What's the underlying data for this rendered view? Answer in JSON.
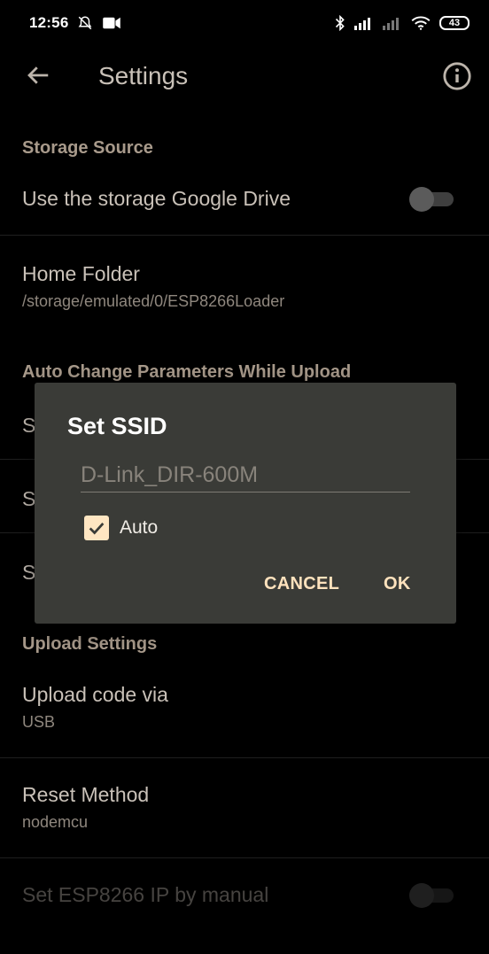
{
  "status": {
    "time": "12:56",
    "battery": "43"
  },
  "appbar": {
    "title": "Settings"
  },
  "sections": {
    "storage": "Storage Source",
    "auto_change": "Auto Change Parameters While Upload",
    "upload": "Upload Settings"
  },
  "rows": {
    "google_drive": {
      "title": "Use the storage Google Drive",
      "enabled": false
    },
    "home_folder": {
      "title": "Home Folder",
      "value": "/storage/emulated/0/ESP8266Loader"
    },
    "hidden_1": "S",
    "hidden_2": "S",
    "hidden_3": "S",
    "upload_via": {
      "title": "Upload code via",
      "value": "USB"
    },
    "reset_method": {
      "title": "Reset Method",
      "value": "nodemcu"
    },
    "manual_ip": {
      "title": "Set ESP8266 IP by manual",
      "enabled": false
    }
  },
  "dialog": {
    "title": "Set SSID",
    "input_value": "D-Link_DIR-600M",
    "checkbox_label": "Auto",
    "checkbox_checked": true,
    "cancel_label": "CANCEL",
    "ok_label": "OK"
  },
  "colors": {
    "background": "#000000",
    "dialog": "#3a3b37",
    "accent": "#ffe2bd",
    "section_header": "#a89a8b"
  }
}
